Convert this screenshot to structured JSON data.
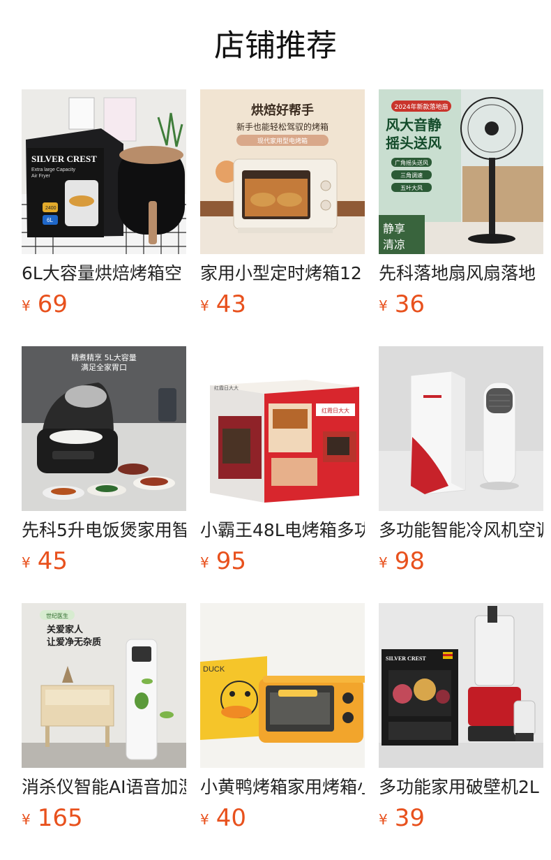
{
  "section": {
    "title": "店铺推荐"
  },
  "products": [
    {
      "name": "6L大容量烘焙烤箱空",
      "currency": "¥",
      "price": "69",
      "image": {
        "alt": "air-fryer-photo",
        "texts": [
          "SILVER CREST",
          "Extra large Capacity",
          "Air Fryer",
          "2400",
          "6L"
        ]
      }
    },
    {
      "name": "家用小型定时烤箱12",
      "currency": "¥",
      "price": "43",
      "image": {
        "alt": "oven-photo",
        "texts": [
          "烘焙好帮手",
          "新手也能轻松驾驭的烤箱",
          "现代家用型电烤箱"
        ]
      }
    },
    {
      "name": "先科落地扇风扇落地",
      "currency": "¥",
      "price": "36",
      "image": {
        "alt": "fan-photo",
        "texts": [
          "2024年新款落地扇",
          "风大音静",
          "摇头送风",
          "广角摇头送风",
          "三角调速",
          "五叶大风",
          "静享",
          "清凉"
        ]
      }
    },
    {
      "name": "先科5升电饭煲家用智",
      "currency": "¥",
      "price": "45",
      "image": {
        "alt": "rice-cooker-photo",
        "texts": [
          "精煮精烹 5L大容量",
          "满足全家胃口"
        ]
      }
    },
    {
      "name": "小霸王48L电烤箱多功",
      "currency": "¥",
      "price": "95",
      "image": {
        "alt": "oven-box-photo",
        "texts": [
          "红霞日大大"
        ]
      }
    },
    {
      "name": "多功能智能冷风机空调",
      "currency": "¥",
      "price": "98",
      "image": {
        "alt": "cooler-photo",
        "texts": []
      }
    },
    {
      "name": "消杀仪智能AI语音加湿",
      "currency": "¥",
      "price": "165",
      "image": {
        "alt": "purifier-photo",
        "texts": [
          "世纪医生",
          "关爱家人",
          "让爱净无杂质"
        ]
      }
    },
    {
      "name": "小黄鸭烤箱家用烤箱小",
      "currency": "¥",
      "price": "40",
      "image": {
        "alt": "duck-oven-photo",
        "texts": [
          "DUCK"
        ]
      }
    },
    {
      "name": "多功能家用破壁机2L",
      "currency": "¥",
      "price": "39",
      "image": {
        "alt": "blender-photo",
        "texts": [
          "SILVER CREST"
        ]
      }
    }
  ]
}
